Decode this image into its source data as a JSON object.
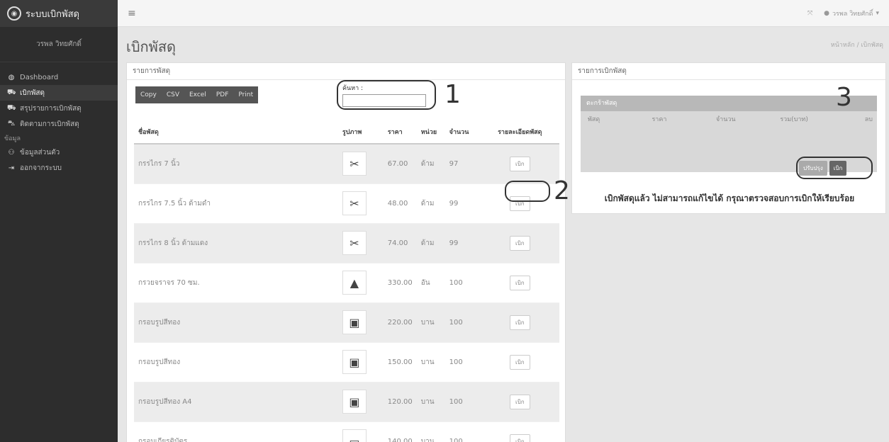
{
  "app": {
    "name": "ระบบเบิกพัสดุ",
    "user_name": "วรพล วิทยศักดิ์"
  },
  "sidebar": {
    "items": [
      {
        "label": "Dashboard"
      },
      {
        "label": "เบิกพัสดุ"
      },
      {
        "label": "สรุปรายการเบิกพัสดุ"
      },
      {
        "label": "ติดตามการเบิกพัสดุ"
      }
    ],
    "section_label": "ข้อมูล",
    "items2": [
      {
        "label": "ข้อมูลส่วนตัว"
      },
      {
        "label": "ออกจากระบบ"
      }
    ]
  },
  "topbar": {
    "user_menu": "วรพล วิทยศักดิ์"
  },
  "page": {
    "title": "เบิกพัสดุ",
    "breadcrumb": "หน้าหลัก / เบิกพัสดุ"
  },
  "left_panel": {
    "title": "รายการพัสดุ",
    "export_buttons": [
      "Copy",
      "CSV",
      "Excel",
      "PDF",
      "Print"
    ],
    "search_label": "ค้นหา :",
    "search_value": "",
    "columns": [
      "ชื่อพัสดุ",
      "รูปภาพ",
      "ราคา",
      "หน่วย",
      "จำนวน",
      "รายละเอียดพัสดุ"
    ],
    "rows": [
      {
        "name": "กรรไกร 7 นิ้ว",
        "price": "67.00",
        "unit": "ด้าม",
        "qty": "97",
        "action": "เบิก"
      },
      {
        "name": "กรรไกร 7.5 นิ้ว ด้ามดำ",
        "price": "48.00",
        "unit": "ด้าม",
        "qty": "99",
        "action": "เบิก"
      },
      {
        "name": "กรรไกร 8 นิ้ว ด้ามแดง",
        "price": "74.00",
        "unit": "ด้าม",
        "qty": "99",
        "action": "เบิก"
      },
      {
        "name": "กรวยจราจร 70 ซม.",
        "price": "330.00",
        "unit": "อัน",
        "qty": "100",
        "action": "เบิก"
      },
      {
        "name": "กรอบรูปสีทอง",
        "price": "220.00",
        "unit": "บาน",
        "qty": "100",
        "action": "เบิก"
      },
      {
        "name": "กรอบรูปสีทอง",
        "price": "150.00",
        "unit": "บาน",
        "qty": "100",
        "action": "เบิก"
      },
      {
        "name": "กรอบรูปสีทอง A4",
        "price": "120.00",
        "unit": "บาน",
        "qty": "100",
        "action": "เบิก"
      },
      {
        "name": "กรอบเกียรติบัตร",
        "price": "140.00",
        "unit": "บาน",
        "qty": "100",
        "action": "เบิก"
      }
    ]
  },
  "right_panel": {
    "title": "รายการเบิกพัสดุ",
    "cart_title": "ตะกร้าพัสดุ",
    "cart_columns": [
      "พัสดุ",
      "ราคา",
      "จำนวน",
      "รวม(บาท)",
      "ลบ"
    ],
    "buttons": {
      "update": "ปรับปรุง",
      "submit": "เบิก"
    },
    "message": "เบิกพัสดุแล้ว ไม่สามารถแก้ไขได้ กรุณาตรวจสอบการเบิกให้เรียบร้อย"
  },
  "callouts": [
    "1",
    "2",
    "3"
  ]
}
